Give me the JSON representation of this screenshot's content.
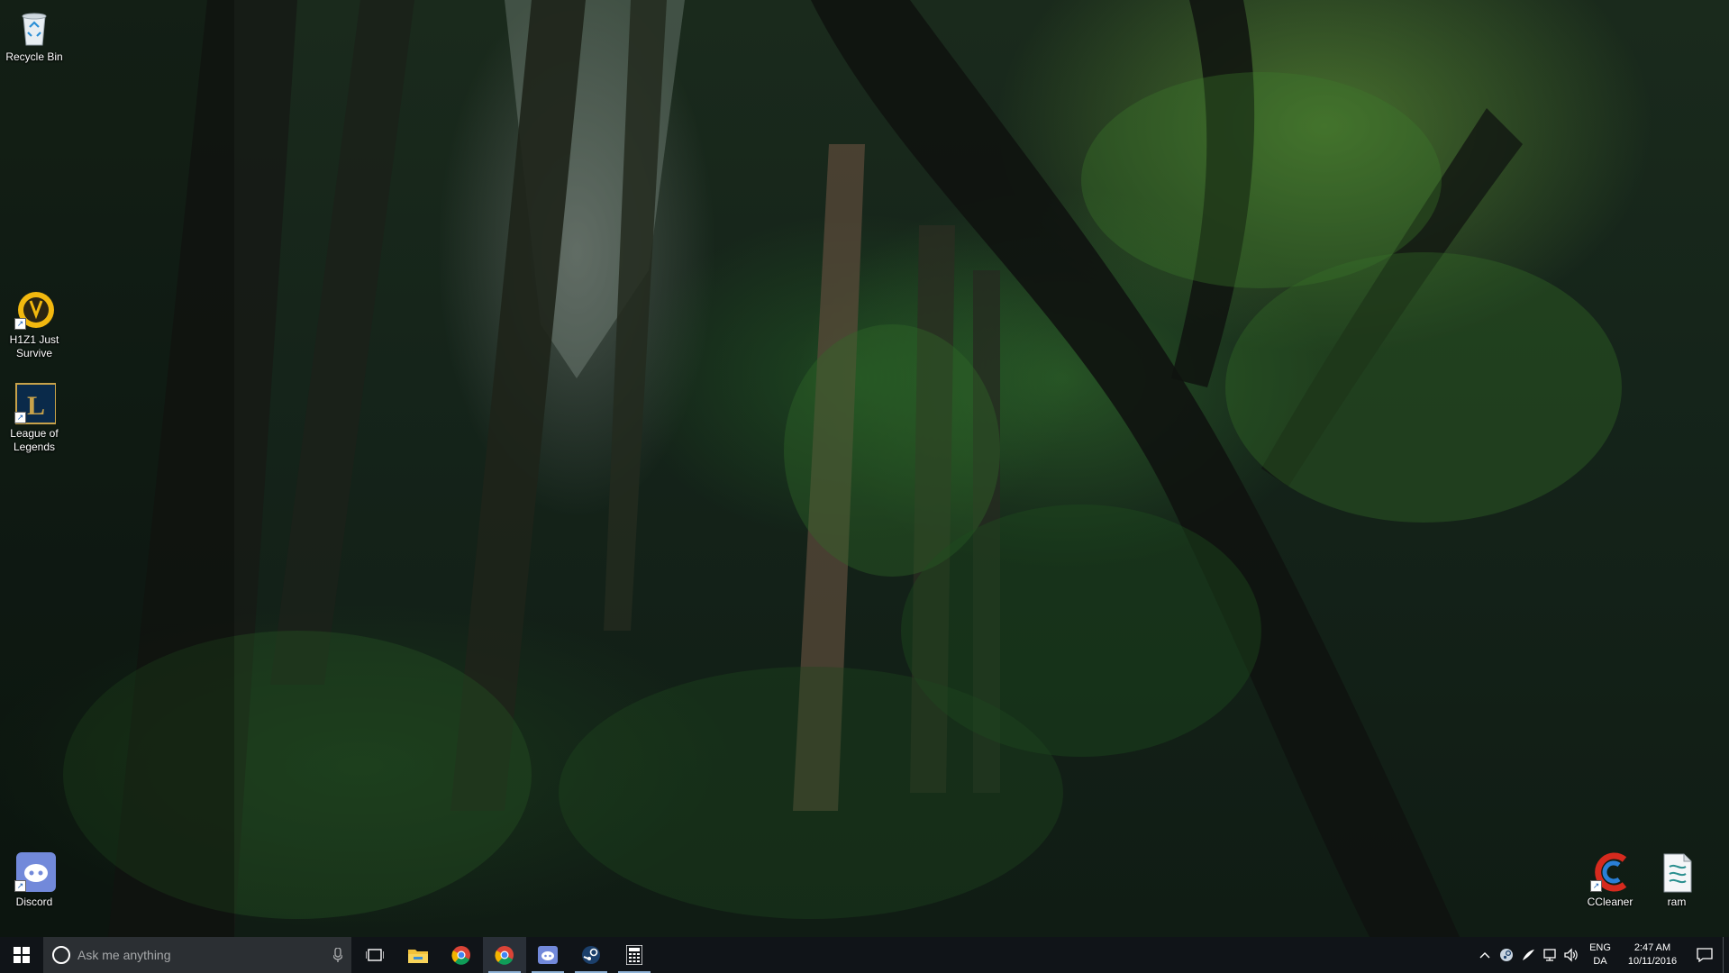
{
  "desktop": {
    "icons_left": [
      {
        "label": "Recycle Bin",
        "icon": "recycle-bin-icon"
      },
      {
        "label": "H1Z1 Just Survive",
        "icon": "h1z1-icon"
      },
      {
        "label": "League of Legends",
        "icon": "league-of-legends-icon"
      },
      {
        "label": "Discord",
        "icon": "discord-icon"
      }
    ],
    "icons_right": [
      {
        "label": "CCleaner",
        "icon": "ccleaner-icon"
      },
      {
        "label": "ram",
        "icon": "text-document-icon"
      }
    ]
  },
  "taskbar": {
    "search_placeholder": "Ask me anything",
    "pinned": [
      {
        "name": "Task View",
        "icon": "task-view-icon"
      },
      {
        "name": "File Explorer",
        "icon": "file-explorer-icon"
      },
      {
        "name": "Google Chrome",
        "icon": "chrome-icon"
      },
      {
        "name": "Google Chrome",
        "icon": "chrome-icon",
        "running": true,
        "active": true
      },
      {
        "name": "Discord",
        "icon": "discord-icon",
        "running": true
      },
      {
        "name": "Steam",
        "icon": "steam-icon",
        "running": true
      },
      {
        "name": "Calculator",
        "icon": "calculator-icon",
        "running": true
      }
    ],
    "tray": {
      "language_line1": "ENG",
      "language_line2": "DA",
      "time": "2:47 AM",
      "date": "10/11/2016"
    }
  },
  "colors": {
    "taskbar_bg": "#101418",
    "search_bg": "#2b2f33",
    "running_indicator": "#8fb2d6"
  }
}
